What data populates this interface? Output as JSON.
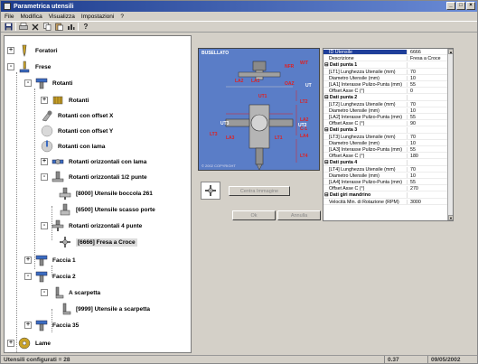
{
  "window": {
    "title": "Parametrica utensili"
  },
  "menu": [
    "File",
    "Modifica",
    "Visualizza",
    "Impostazioni",
    "?"
  ],
  "toolbar": {
    "icons": [
      "save-icon",
      "print-icon",
      "delete-icon",
      "copy-icon",
      "paste-icon",
      "columns-icon",
      "help-icon"
    ]
  },
  "tree": {
    "nodes": [
      {
        "label": "Foratori",
        "expander": "+",
        "icon": "drill-icon"
      },
      {
        "label": "Frese",
        "expander": "-",
        "icon": "mill-icon"
      },
      {
        "label": "Rotanti",
        "expander": "-",
        "icon": "tool-holder-icon"
      },
      {
        "label": "Rotanti",
        "expander": "+",
        "icon": "rotary-tool-icon"
      },
      {
        "label": "Rotanti con offset X",
        "expander": "",
        "icon": "offset-x-icon"
      },
      {
        "label": "Rotanti con offset Y",
        "expander": "",
        "icon": "offset-y-icon"
      },
      {
        "label": "Rotanti con lama",
        "expander": "",
        "icon": "blade-icon"
      },
      {
        "label": "Rotanti orizzontali con lama",
        "expander": "+",
        "icon": "horizontal-blade-icon"
      },
      {
        "label": "Rotanti orizzontali 1/2 punte",
        "expander": "-",
        "icon": "horizontal-tips-icon"
      },
      {
        "label": "[8000] Utensile boccola 261",
        "expander": "",
        "icon": "bushing-tool-icon"
      },
      {
        "label": "[6500] Utensile scasso porte",
        "expander": "",
        "icon": "door-tool-icon"
      },
      {
        "label": "Rotanti orizzontali 4 punte",
        "expander": "-",
        "icon": "four-tip-icon"
      },
      {
        "label": "[6666] Fresa a Croce",
        "expander": "",
        "icon": "cross-cutter-icon",
        "selected": true
      },
      {
        "label": "Faccia 1",
        "expander": "+",
        "icon": "face-icon"
      },
      {
        "label": "Faccia 2",
        "expander": "-",
        "icon": "face-icon"
      },
      {
        "label": "A scarpetta",
        "expander": "-",
        "icon": "shoe-icon"
      },
      {
        "label": "[9999] Utensile a scarpetta",
        "expander": "",
        "icon": "shoe-tool-icon"
      },
      {
        "label": "Faccia 35",
        "expander": "+",
        "icon": "face-icon"
      },
      {
        "label": "Lame",
        "expander": "+",
        "icon": "saw-blade-icon"
      }
    ]
  },
  "preview": {
    "brand": "BUSELLATO",
    "copyright": "© 2002 COPYRIGHT",
    "labels": {
      "nfr": "NFR",
      "wt": "W/T",
      "la2_top": "LA2",
      "la1": "LA1",
      "oaz": "OAZ",
      "ut": "UT",
      "ut1": "UT1",
      "ut2": "UT2",
      "ut3": "UT3",
      "lt1": "LT1",
      "lt2": "LT2",
      "lt3": "LT3",
      "lt4": "LT4",
      "la2": "LA2",
      "la3": "LA3",
      "la4": "LA4",
      "c1": "C-1"
    }
  },
  "buttons": {
    "canonical_view": "Centra Immagine",
    "ok": "Ok",
    "cancel": "Annulla"
  },
  "properties": {
    "rows": [
      {
        "key": "ID Utensile",
        "value": "6666",
        "type": "selected"
      },
      {
        "key": "Descrizione",
        "value": "Fresa a Croce",
        "type": "field"
      },
      {
        "key": "Dati punta 1",
        "value": "",
        "type": "section"
      },
      {
        "key": "[LT1] Lunghezza Utensile (mm)",
        "value": "70",
        "type": "field"
      },
      {
        "key": "Diametro Utensile (mm)",
        "value": "10",
        "type": "field"
      },
      {
        "key": "[LA1] Interasse Pulizo-Punta (mm)",
        "value": "55",
        "type": "field"
      },
      {
        "key": "Offset Asse C (°)",
        "value": "0",
        "type": "field"
      },
      {
        "key": "Dati punta 2",
        "value": "",
        "type": "section"
      },
      {
        "key": "[LT2] Lunghezza Utensile (mm)",
        "value": "70",
        "type": "field"
      },
      {
        "key": "Diametro Utensile (mm)",
        "value": "10",
        "type": "field"
      },
      {
        "key": "[LA2] Interasse Pulizo-Punta (mm)",
        "value": "55",
        "type": "field"
      },
      {
        "key": "Offset Asse C (°)",
        "value": "90",
        "type": "field"
      },
      {
        "key": "Dati punta 3",
        "value": "",
        "type": "section"
      },
      {
        "key": "[LT3] Lunghezza Utensile (mm)",
        "value": "70",
        "type": "field"
      },
      {
        "key": "Diametro Utensile (mm)",
        "value": "10",
        "type": "field"
      },
      {
        "key": "[LA3] Interasse Pulizo-Punta (mm)",
        "value": "55",
        "type": "field"
      },
      {
        "key": "Offset Asse C (°)",
        "value": "180",
        "type": "field"
      },
      {
        "key": "Dati punta 4",
        "value": "",
        "type": "section"
      },
      {
        "key": "[LT4] Lunghezza Utensile (mm)",
        "value": "70",
        "type": "field"
      },
      {
        "key": "Diametro Utensile (mm)",
        "value": "10",
        "type": "field"
      },
      {
        "key": "[LA4] Interasse Pulizo-Punta (mm)",
        "value": "55",
        "type": "field"
      },
      {
        "key": "Offset Asse C (°)",
        "value": "270",
        "type": "field"
      },
      {
        "key": "Dati giri mandrino",
        "value": "",
        "type": "section"
      },
      {
        "key": "Velocità Min. di Rotazione (RPM)",
        "value": "3000",
        "type": "field"
      }
    ]
  },
  "status": {
    "configured": "Utensili configurati = 28",
    "version": "0.37",
    "date": "09/05/2002"
  },
  "colors": {
    "selection": "#1f3f9a",
    "preview_bg": "#5a7dc7",
    "dimension_red": "#e02020"
  }
}
